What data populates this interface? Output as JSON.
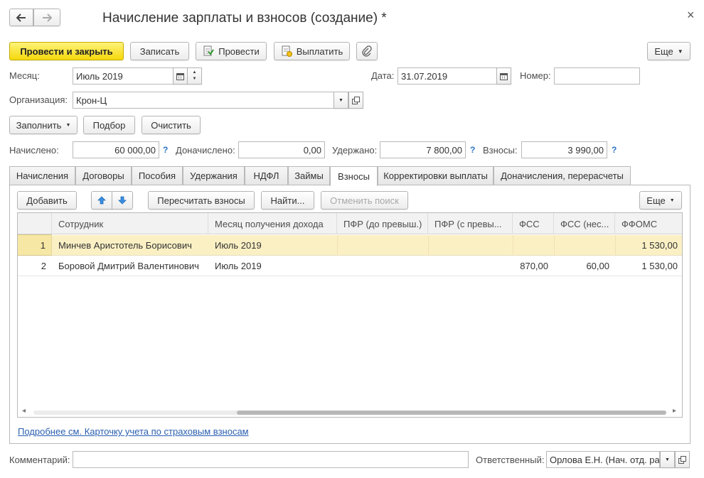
{
  "window": {
    "title": "Начисление зарплаты и взносов (создание) *",
    "close_glyph": "×",
    "back_icon": "arrow-left-icon",
    "forward_icon": "arrow-right-icon"
  },
  "toolbar": {
    "post_close": "Провести и закрыть",
    "save": "Записать",
    "post": "Провести",
    "pay": "Выплатить",
    "more": "Еще"
  },
  "header": {
    "month_label": "Месяц:",
    "month_value": "Июль 2019",
    "date_label": "Дата:",
    "date_value": "31.07.2019",
    "number_label": "Номер:",
    "number_value": "",
    "org_label": "Организация:",
    "org_value": "Крон-Ц"
  },
  "actions": {
    "fill": "Заполнить",
    "select": "Подбор",
    "clear": "Очистить"
  },
  "totals": {
    "accrued_label": "Начислено:",
    "accrued_value": "60 000,00",
    "extra_label": "Доначислено:",
    "extra_value": "0,00",
    "withheld_label": "Удержано:",
    "withheld_value": "7 800,00",
    "contrib_label": "Взносы:",
    "contrib_value": "3 990,00",
    "help": "?"
  },
  "tabs": [
    {
      "label": "Начисления"
    },
    {
      "label": "Договоры"
    },
    {
      "label": "Пособия"
    },
    {
      "label": "Удержания"
    },
    {
      "label": "НДФЛ"
    },
    {
      "label": "Займы"
    },
    {
      "label": "Взносы"
    },
    {
      "label": "Корректировки выплаты"
    },
    {
      "label": "Доначисления, перерасчеты"
    }
  ],
  "active_tab": "Взносы",
  "tab_toolbar": {
    "add": "Добавить",
    "recalc": "Пересчитать взносы",
    "find": "Найти...",
    "cancel_search": "Отменить поиск",
    "more": "Еще"
  },
  "table": {
    "columns": [
      "Сотрудник",
      "Месяц получения дохода",
      "ПФР (до превыш.)",
      "ПФР (с превы...",
      "ФСС",
      "ФСС (нес...",
      "ФФОМС"
    ],
    "rows": [
      {
        "n": "1",
        "employee": "Минчев Аристотель Борисович",
        "month": "Июль 2019",
        "pfr1": "",
        "pfr2": "",
        "fss": "",
        "fss_ns": "",
        "ffoms": "1 530,00"
      },
      {
        "n": "2",
        "employee": "Боровой Дмитрий Валентинович",
        "month": "Июль 2019",
        "pfr1": "",
        "pfr2": "",
        "fss": "870,00",
        "fss_ns": "60,00",
        "ffoms": "1 530,00"
      }
    ],
    "scroll_left": "◂",
    "scroll_right": "▸"
  },
  "link": "Подробнее см. Карточку учета по страховым взносам",
  "footer": {
    "comment_label": "Комментарий:",
    "comment_value": "",
    "responsible_label": "Ответственный:",
    "responsible_value": "Орлова Е.Н. (Нач. отд. ра"
  },
  "colors": {
    "primary_button": "#f5d80b",
    "selected_row": "#fbf0c4",
    "link": "#2a5fb0"
  }
}
